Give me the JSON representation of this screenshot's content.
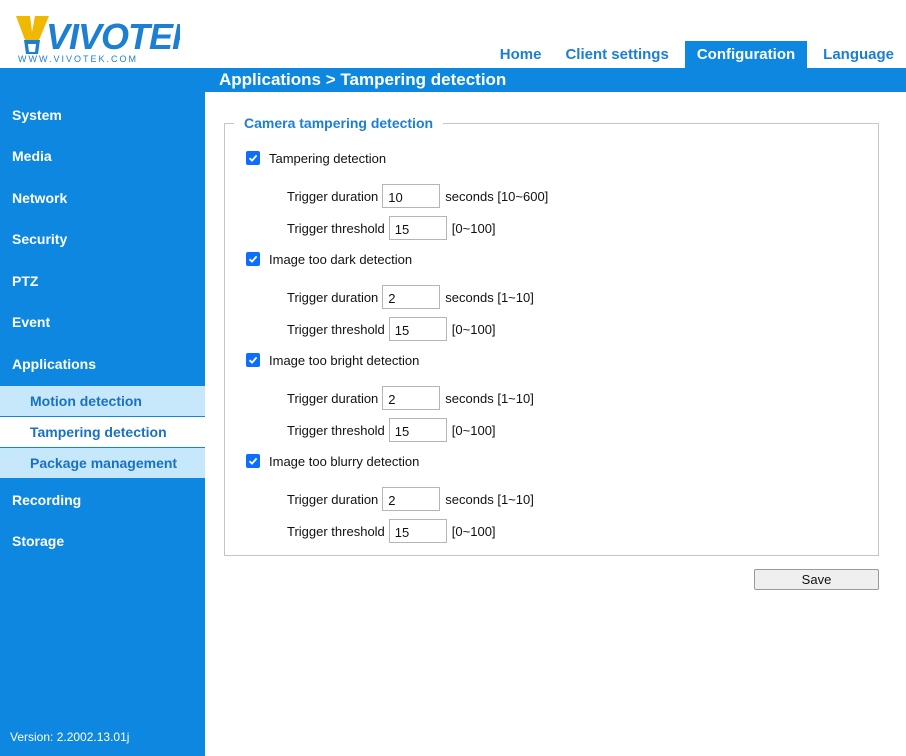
{
  "logo": {
    "brand": "VIVOTEK",
    "url_text": "WWW.VIVOTEK.COM"
  },
  "nav": {
    "tabs": [
      {
        "label": "Home",
        "active": false
      },
      {
        "label": "Client settings",
        "active": false
      },
      {
        "label": "Configuration",
        "active": true
      },
      {
        "label": "Language",
        "active": false
      }
    ]
  },
  "page_title": "Applications  > Tampering detection",
  "sidebar": {
    "items": [
      {
        "label": "System"
      },
      {
        "label": "Media"
      },
      {
        "label": "Network"
      },
      {
        "label": "Security"
      },
      {
        "label": "PTZ"
      },
      {
        "label": "Event"
      },
      {
        "label": "Applications"
      },
      {
        "label": "Recording"
      },
      {
        "label": "Storage"
      }
    ],
    "subitems": [
      {
        "label": "Motion detection",
        "selected": false
      },
      {
        "label": "Tampering detection",
        "selected": true
      },
      {
        "label": "Package management",
        "selected": false
      }
    ],
    "version": "Version: 2.2002.13.01j"
  },
  "form": {
    "legend": "Camera tampering detection",
    "duration_label": "Trigger duration",
    "threshold_label": "Trigger threshold",
    "sections": [
      {
        "label": "Tampering detection",
        "checked": true,
        "duration": "10",
        "duration_range": "seconds [10~600]",
        "threshold": "15",
        "threshold_range": "[0~100]"
      },
      {
        "label": "Image too dark detection",
        "checked": true,
        "duration": "2",
        "duration_range": "seconds [1~10]",
        "threshold": "15",
        "threshold_range": "[0~100]"
      },
      {
        "label": "Image too bright detection",
        "checked": true,
        "duration": "2",
        "duration_range": "seconds [1~10]",
        "threshold": "15",
        "threshold_range": "[0~100]"
      },
      {
        "label": "Image too blurry detection",
        "checked": true,
        "duration": "2",
        "duration_range": "seconds [1~10]",
        "threshold": "15",
        "threshold_range": "[0~100]"
      }
    ],
    "save_label": "Save"
  },
  "colors": {
    "brand_blue": "#0d87e0",
    "link_blue": "#1c7fd1",
    "submenu_bg": "#c7e7fb",
    "checkbox_blue": "#0d6efd"
  }
}
